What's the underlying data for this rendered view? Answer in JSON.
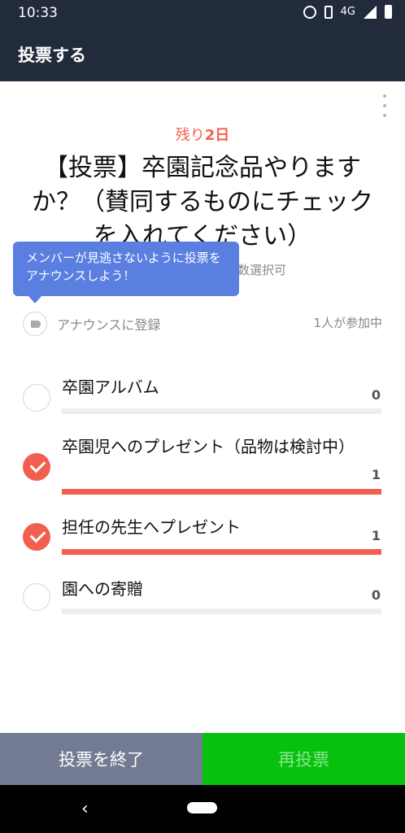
{
  "status": {
    "time": "10:33",
    "network": "4G"
  },
  "appbar": {
    "title": "投票する"
  },
  "poll": {
    "remaining_prefix": "残り",
    "remaining_days": "2日",
    "question": "【投票】卒園記念品やりますか？（賛同するものにチェックを入れてください）",
    "multi_label": "数選択可",
    "tooltip": "メンバーが見逃さないように投票をアナウンスしよう！",
    "announce_label": "アナウンスに登録",
    "participants": "1人が参加中",
    "options": [
      {
        "label": "卒園アルバム",
        "count": "0",
        "checked": false,
        "fraction": 0
      },
      {
        "label": "卒園児へのプレゼント（品物は検討中）",
        "count": "1",
        "checked": true,
        "fraction": 1
      },
      {
        "label": "担任の先生へプレゼント",
        "count": "1",
        "checked": true,
        "fraction": 1
      },
      {
        "label": "園への寄贈",
        "count": "0",
        "checked": false,
        "fraction": 0
      }
    ]
  },
  "footer": {
    "end_label": "投票を終了",
    "revote_label": "再投票"
  },
  "colors": {
    "accent": "#f35f4e",
    "header": "#222b3c",
    "tooltip": "#5a7fe1",
    "revote": "#06c20d",
    "end": "#727b91"
  }
}
